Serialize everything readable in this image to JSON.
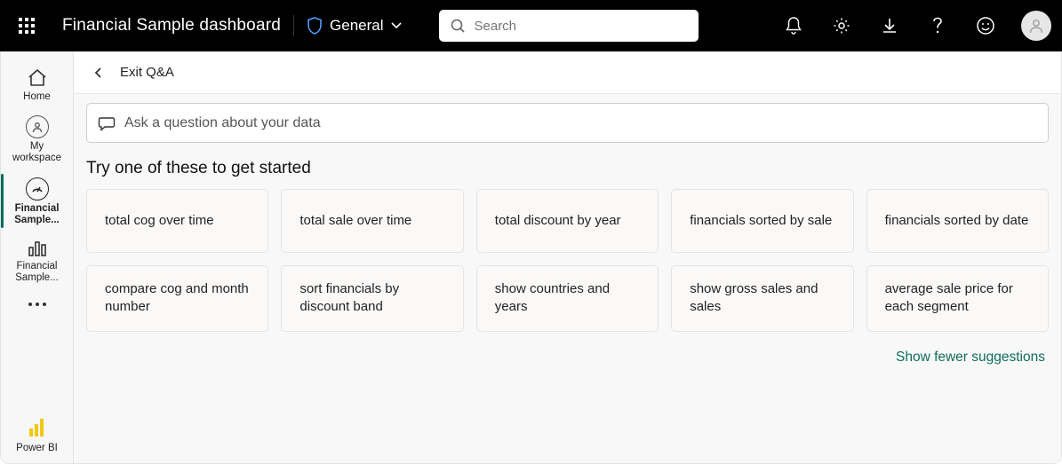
{
  "header": {
    "title": "Financial Sample  dashboard",
    "sensitivity": "General",
    "search_placeholder": "Search"
  },
  "leftnav": {
    "home": "Home",
    "my_workspace_l1": "My",
    "my_workspace_l2": "workspace",
    "financial1_l1": "Financial",
    "financial1_l2": "Sample...",
    "financial2_l1": "Financial",
    "financial2_l2": "Sample...",
    "powerbi": "Power BI"
  },
  "page": {
    "exit_label": "Exit Q&A",
    "ask_placeholder": "Ask a question about your data",
    "try_title": "Try one of these to get started",
    "show_link": "Show fewer suggestions"
  },
  "suggestions": [
    "total cog over time",
    "total sale over time",
    "total discount by year",
    "financials sorted by sale",
    "financials sorted by date",
    "compare cog and month number",
    "sort financials by discount band",
    "show countries and years",
    "show gross sales and sales",
    "average sale price for each segment"
  ]
}
